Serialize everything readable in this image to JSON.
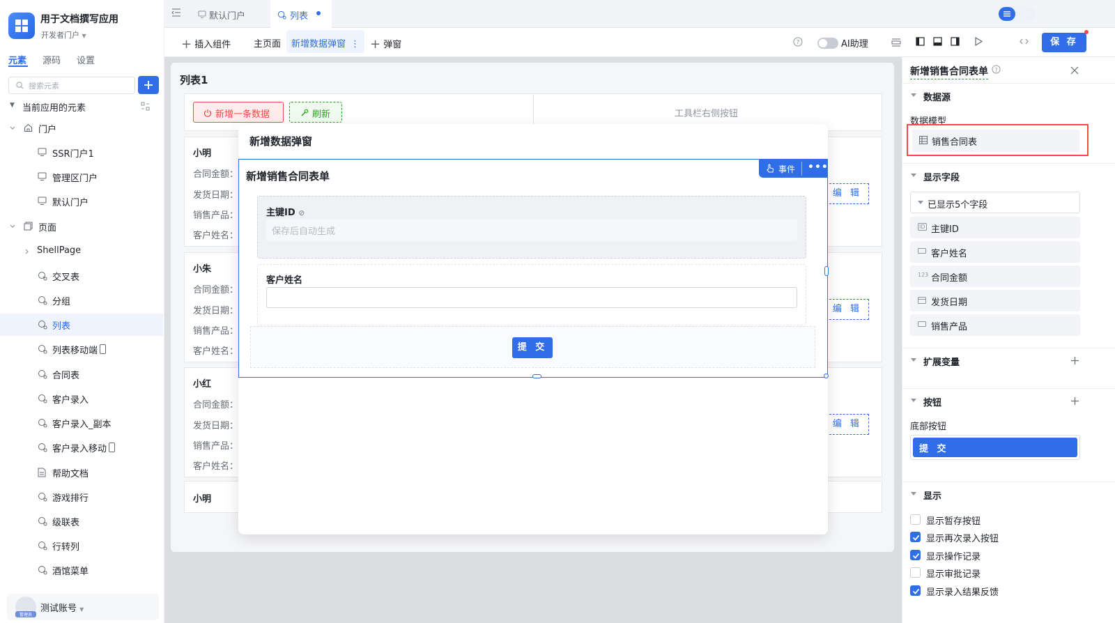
{
  "app": {
    "name": "用于文档撰写应用",
    "subtitle": "开发者门户"
  },
  "sidebar": {
    "tabs": [
      "元素",
      "源码",
      "设置"
    ],
    "search_placeholder": "搜索元素",
    "section_title": "当前应用的元素",
    "tree": {
      "portal": {
        "label": "门户",
        "children": [
          "SSR门户1",
          "管理区门户",
          "默认门户"
        ]
      },
      "pages": {
        "label": "页面",
        "shell": "ShellPage",
        "children": [
          "交叉表",
          "分组",
          "列表",
          "列表移动端",
          "合同表",
          "客户录入",
          "客户录入_副本",
          "客户录入移动",
          "帮助文档",
          "游戏排行",
          "级联表",
          "行转列",
          "酒馆菜单"
        ]
      }
    },
    "user": {
      "name": "测试账号",
      "role": "管理员"
    }
  },
  "tabs": [
    {
      "label": "默认门户"
    },
    {
      "label": "列表"
    }
  ],
  "toolbar": {
    "insert": "插入组件",
    "main_page": "主页面",
    "active_dialog": "新增数据弹窗",
    "add_dialog": "弹窗",
    "ai_label": "AI助理",
    "save": "保 存"
  },
  "canvas": {
    "list_title": "列表1",
    "add_btn": "新增一条数据",
    "refresh_btn": "刷新",
    "toolbar_right": "工具栏右侧按钮",
    "field_labels": [
      "合同金额：",
      "发货日期：",
      "销售产品：",
      "客户姓名："
    ],
    "edit": "编 辑",
    "records": [
      "小明",
      "小朱",
      "小红",
      "小明"
    ]
  },
  "modal": {
    "title": "新增数据弹窗",
    "form_title": "新增销售合同表单",
    "event_btn": "事件",
    "more": "•••",
    "pk_label": "主键ID",
    "pk_placeholder": "保存后自动生成",
    "customer_label": "客户姓名",
    "submit": "提 交"
  },
  "panel": {
    "title": "新增销售合同表单",
    "datasource": {
      "title": "数据源",
      "model_label": "数据模型",
      "model": "销售合同表"
    },
    "fields": {
      "title": "显示字段",
      "summary": "已显示5个字段",
      "items": [
        {
          "label": "主键ID",
          "icon": "ID"
        },
        {
          "label": "客户姓名",
          "icon": "text-field-icon"
        },
        {
          "label": "合同金额",
          "icon": "123"
        },
        {
          "label": "发货日期",
          "icon": "calendar-icon"
        },
        {
          "label": "销售产品",
          "icon": "text-field-icon"
        }
      ]
    },
    "ext_vars": {
      "title": "扩展变量"
    },
    "buttons": {
      "title": "按钮",
      "bottom_label": "底部按钮",
      "bottom_btn": "提 交"
    },
    "display": {
      "title": "显示",
      "options": [
        {
          "label": "显示暂存按钮",
          "checked": false
        },
        {
          "label": "显示再次录入按钮",
          "checked": true
        },
        {
          "label": "显示操作记录",
          "checked": true
        },
        {
          "label": "显示审批记录",
          "checked": false
        },
        {
          "label": "显示录入结果反馈",
          "checked": true
        }
      ]
    }
  },
  "colors": {
    "accent": "#2f6ee6",
    "danger": "#f54a45",
    "success": "#2ea121"
  }
}
